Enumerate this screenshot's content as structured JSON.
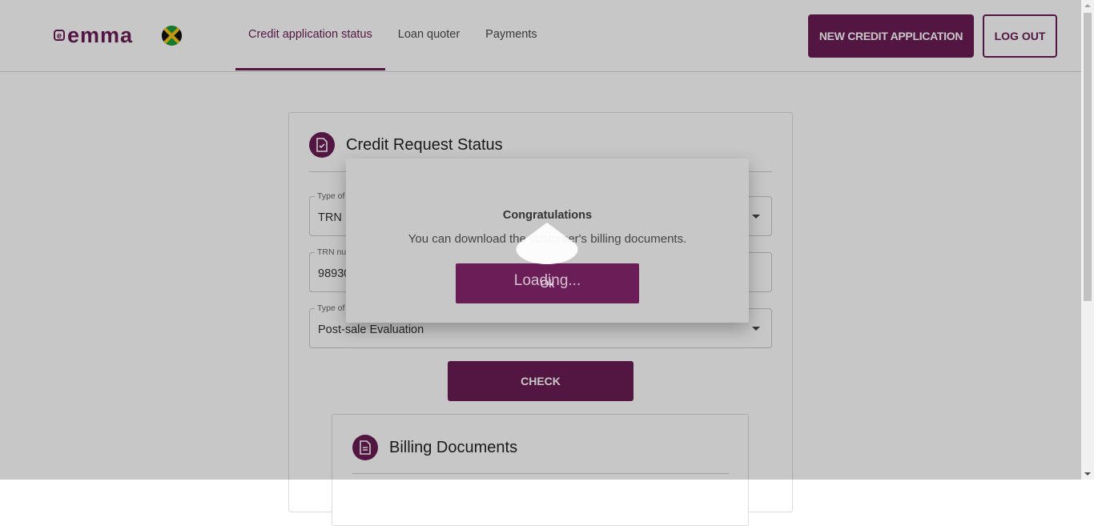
{
  "brand": {
    "name": "emma",
    "accent": "#6b1d57"
  },
  "nav": {
    "items": [
      {
        "label": "Credit application status",
        "active": true
      },
      {
        "label": "Loan quoter",
        "active": false
      },
      {
        "label": "Payments",
        "active": false
      }
    ]
  },
  "header_buttons": {
    "new_application": "NEW CREDIT APPLICATION",
    "logout": "LOG OUT"
  },
  "card": {
    "title": "Credit Request Status",
    "fields": [
      {
        "label": "Type of",
        "value": "TRN",
        "dropdown": true
      },
      {
        "label": "TRN nu",
        "value": "98930",
        "dropdown": false
      },
      {
        "label": "Type of",
        "value": "Post-sale Evaluation",
        "dropdown": true
      }
    ],
    "check_label": "CHECK"
  },
  "billing": {
    "title": "Billing Documents"
  },
  "modal": {
    "title": "Congratulations",
    "message": "You can download the customer's billing documents.",
    "button_label": "Ok",
    "loading": "Loading..."
  }
}
